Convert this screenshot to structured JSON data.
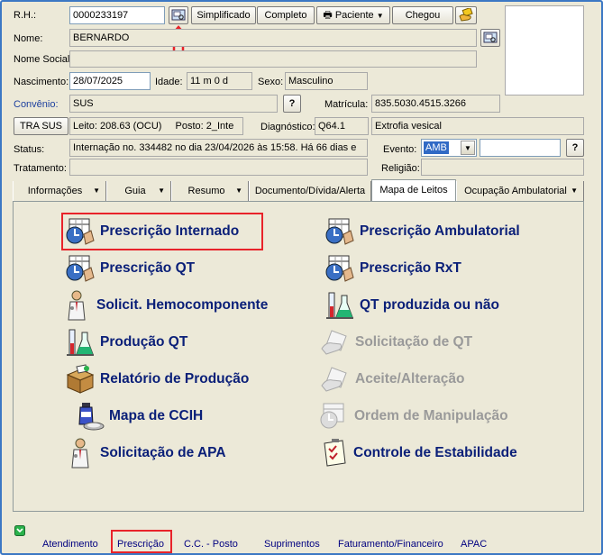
{
  "labels": {
    "rh": "R.H.:",
    "nome": "Nome:",
    "nome_social": "Nome Social:",
    "nascimento": "Nascimento:",
    "idade": "Idade:",
    "sexo": "Sexo:",
    "convenio": "Convênio:",
    "matricula": "Matrícula:",
    "posto": "Posto:",
    "diagnostico": "Diagnóstico:",
    "status": "Status:",
    "evento": "Evento:",
    "tratamento": "Tratamento:",
    "religiao": "Religião:"
  },
  "values": {
    "rh": "0000233197",
    "nome": "BERNARDO",
    "nome_social": "",
    "nascimento": "28/07/2025",
    "idade": "11 m 0 d",
    "sexo": "Masculino",
    "convenio": "SUS",
    "matricula": "835.5030.4515.3266",
    "leito": "Leito: 208.63 (OCU)",
    "posto": "2_Inte",
    "diagnostico_code": "Q64.1",
    "diagnostico_desc": "Extrofia vesical",
    "status": "Internação no. 334482 no dia 23/04/2026  às  15:58. Há 66 dias e",
    "evento": "AMB",
    "evento_extra": "",
    "tratamento": "",
    "religiao": ""
  },
  "buttons": {
    "simplificado": "Simplificado",
    "completo": "Completo",
    "paciente": "Paciente",
    "chegou": "Chegou",
    "tra_sus": "TRA SUS",
    "help": "?"
  },
  "tabs": [
    {
      "label": "Informações",
      "caret": "▼"
    },
    {
      "label": "Guia",
      "caret": "▼"
    },
    {
      "label": "Resumo",
      "caret": "▼"
    },
    {
      "label": "Documento/Dívida/Alerta",
      "caret": ""
    },
    {
      "label": "Mapa de Leitos",
      "caret": ""
    },
    {
      "label": "Ocupação Ambulatorial",
      "caret": "▼"
    }
  ],
  "menu": {
    "left": [
      {
        "label": "Prescrição Internado",
        "icon": "calendar-clock-icon",
        "enabled": true
      },
      {
        "label": "Prescrição QT",
        "icon": "calendar-clock-icon",
        "enabled": true
      },
      {
        "label": "Solicit. Hemocomponente",
        "icon": "doctor-icon",
        "enabled": true
      },
      {
        "label": "Produção QT",
        "icon": "lab-flask-icon",
        "enabled": true
      },
      {
        "label": "Relatório de Produção",
        "icon": "box-icon",
        "enabled": true
      },
      {
        "label": "Mapa de CCIH",
        "icon": "bottle-icon",
        "enabled": true
      },
      {
        "label": "Solicitação de APA",
        "icon": "doctor-icon",
        "enabled": true
      }
    ],
    "right": [
      {
        "label": "Prescrição Ambulatorial",
        "icon": "calendar-clock-icon",
        "enabled": true
      },
      {
        "label": "Prescrição RxT",
        "icon": "calendar-clock-icon",
        "enabled": true
      },
      {
        "label": "QT produzida ou não",
        "icon": "lab-flask-icon",
        "enabled": true
      },
      {
        "label": "Solicitação de QT",
        "icon": "hand-paper-icon",
        "enabled": false
      },
      {
        "label": "Aceite/Alteração",
        "icon": "hand-paper-icon",
        "enabled": false
      },
      {
        "label": "Ordem de Manipulação",
        "icon": "calendar-clock-icon",
        "enabled": false
      },
      {
        "label": "Controle de Estabilidade",
        "icon": "checklist-icon",
        "enabled": true
      }
    ]
  },
  "bottom_tabs": [
    "Atendimento",
    "Prescrição",
    "C.C. - Posto",
    "Suprimentos",
    "Faturamento/Financeiro",
    "APAC"
  ],
  "colors": {
    "accent": "#0a1f78",
    "highlight": "#e8232a",
    "window_border": "#3c78c4"
  }
}
